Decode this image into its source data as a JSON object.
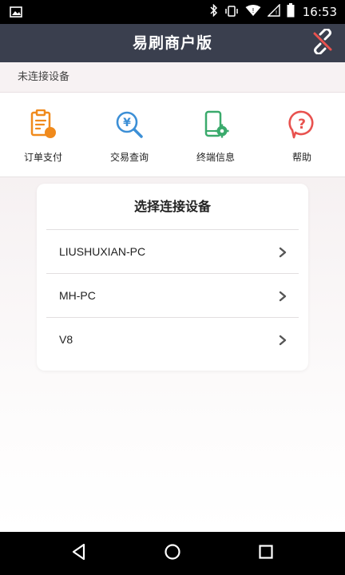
{
  "status_bar": {
    "time": "16:53",
    "icons": [
      "image-icon",
      "bluetooth-icon",
      "vibrate-icon",
      "wifi-icon",
      "signal-icon",
      "battery-icon"
    ]
  },
  "app_bar": {
    "title": "易刷商户版",
    "action_icon": "link-broken-icon"
  },
  "connection_status": "未连接设备",
  "menu": {
    "items": [
      {
        "label": "订单支付",
        "icon": "order-pay-icon",
        "color": "#f08a1c"
      },
      {
        "label": "交易查询",
        "icon": "transaction-search-icon",
        "color": "#3c8fd6"
      },
      {
        "label": "终端信息",
        "icon": "terminal-info-icon",
        "color": "#3aaa6c"
      },
      {
        "label": "帮助",
        "icon": "help-icon",
        "color": "#e8524f"
      }
    ]
  },
  "dialog": {
    "title": "选择连接设备",
    "devices": [
      {
        "name": "LIUSHUXIAN-PC"
      },
      {
        "name": "MH-PC"
      },
      {
        "name": "V8"
      }
    ]
  },
  "colors": {
    "app_bar_bg": "#3a3f4e",
    "link_icon": "#e8524f"
  }
}
